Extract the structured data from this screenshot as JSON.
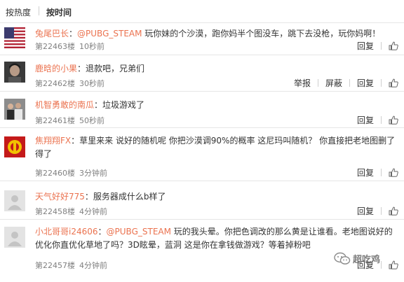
{
  "sort": {
    "hot_label": "按热度",
    "time_label": "按时间"
  },
  "comments": [
    {
      "username": "兔尾巴长",
      "colon": "：",
      "mention": "@PUBG_STEAM",
      "text": " 玩你妹的个沙漠，跑你妈半个图没车，跳下去没枪，玩你妈啊！",
      "floor": "第22463楼",
      "time": "10秒前",
      "reply": "回复",
      "avatar": "us-flag-avatar"
    },
    {
      "username": "鹿晗的小果",
      "colon": "：",
      "text": "退款吧，兄弟们",
      "floor": "第22462楼",
      "time": "30秒前",
      "report": "举报",
      "block": "屏蔽",
      "reply": "回复",
      "avatar": "dark-portrait-avatar"
    },
    {
      "username": "机智勇敢的南瓜",
      "colon": "：",
      "text": "垃圾游戏了",
      "floor": "第22461楼",
      "time": "50秒前",
      "reply": "回复",
      "avatar": "group-photo-avatar"
    },
    {
      "username": "焦翔翔FX",
      "colon": "：",
      "text": "草里来来  说好的随机呢  你把沙漠调90%的概率 这尼玛叫随机？  你直接把老地图删了得了",
      "floor": "第22460楼",
      "time": "3分钟前",
      "reply": "回复",
      "avatar": "red-emblem-avatar"
    },
    {
      "username": "天气好好775",
      "colon": "：",
      "text": "服务器成什么b样了",
      "floor": "第22458楼",
      "time": "4分钟前",
      "reply": "回复",
      "avatar": "default-avatar"
    },
    {
      "username": "小北哥哥i24606",
      "colon": "：",
      "mention": "@PUBG_STEAM",
      "text": " 玩的我头晕。你把色调改的那么黄是让谁看。老地图说好的优化你直优化草地了吗？3D眩晕，蓝洞 这是你在拿钱做游戏？等着掉粉吧",
      "floor": "第22457楼",
      "time": "4分钟前",
      "reply": "回复",
      "avatar": "default-avatar"
    }
  ],
  "watermark": {
    "text": "超吃鸡",
    "icon": "wechat-icon"
  },
  "colors": {
    "username": "#eb7350",
    "meta": "#808080",
    "divider": "#e6e6e6"
  }
}
